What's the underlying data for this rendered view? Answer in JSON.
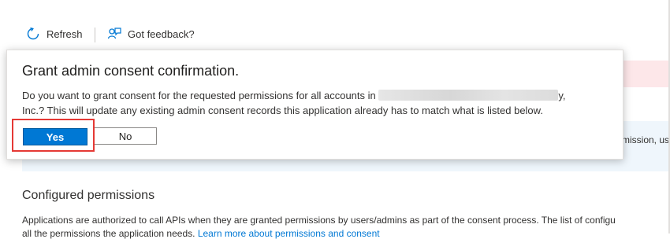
{
  "toolbar": {
    "refresh_label": "Refresh",
    "feedback_label": "Got feedback?"
  },
  "dialog": {
    "title": "Grant admin consent confirmation.",
    "message_part1": "Do you want to grant consent for the requested permissions for all accounts in",
    "message_part2": "y,",
    "message_line2": "Inc.? This will update any existing admin consent records this application already has to match what is listed below.",
    "yes_label": "Yes",
    "no_label": "No"
  },
  "background": {
    "info_text_fragment": "mission, use",
    "configured_permissions_title": "Configured permissions",
    "configured_permissions_desc": "Applications are authorized to call APIs when they are granted permissions by users/admins as part of the consent process. The list of configu",
    "configured_permissions_desc2": "all the permissions the application needs.",
    "learn_more_link": "Learn more about permissions and consent"
  },
  "colors": {
    "accent": "#0078d4",
    "highlight": "#e53935"
  }
}
